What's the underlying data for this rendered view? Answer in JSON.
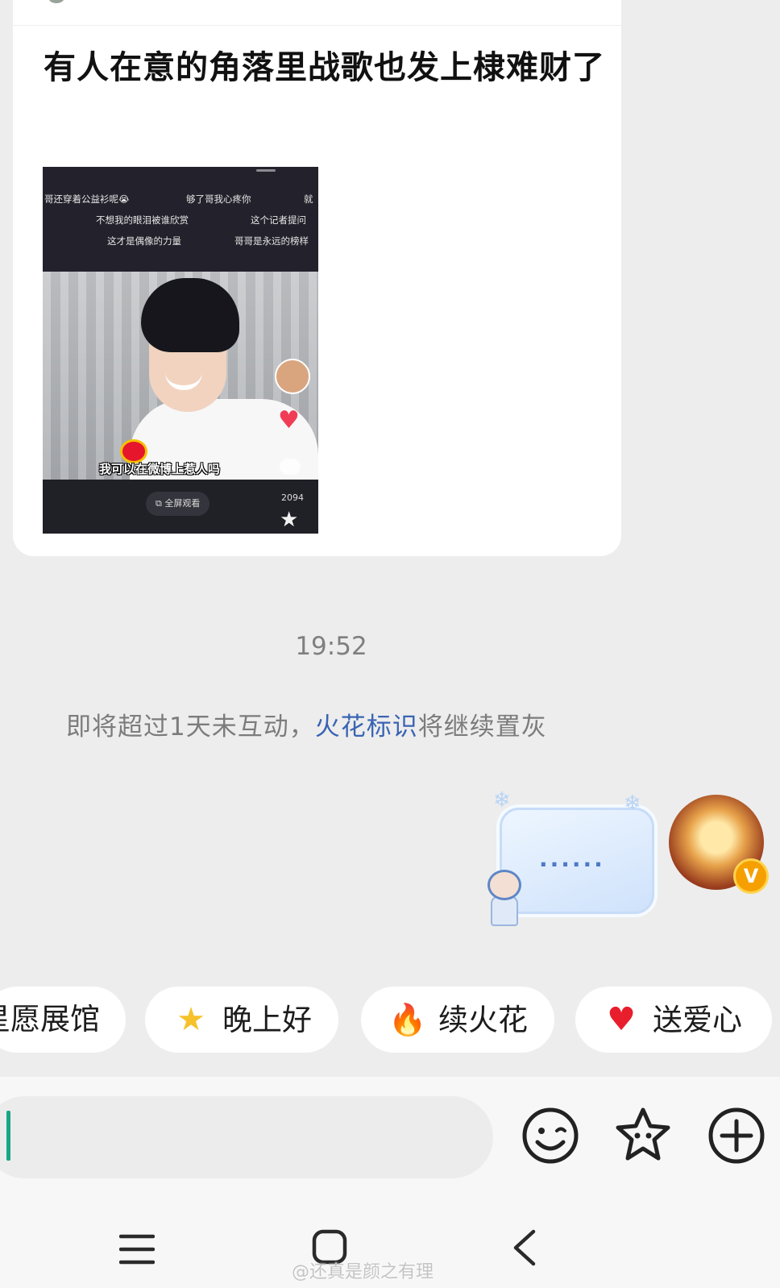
{
  "shared_post": {
    "title": "有人在意的角落里战歌也发上棣难财了",
    "video": {
      "danmaku": [
        "哥还穿着公益衫呢😭",
        "够了哥我心疼你",
        "就",
        "不想我的眼泪被谁欣赏",
        "这个记者提问",
        "这才是偶像的力量",
        "哥哥是永远的榜样"
      ],
      "subtitle": "我可以在微博上惹人吗",
      "fullscreen_label": "全屏观看",
      "comment_count": "2094"
    }
  },
  "chat": {
    "timestamp": "19:52",
    "notice_prefix": "即将超过1天未互动，",
    "notice_link": "火花标识",
    "notice_suffix": "将继续置灰",
    "my_message": "......",
    "vip_badge": "V"
  },
  "quick_replies": [
    {
      "label": "星愿展馆",
      "icon": ""
    },
    {
      "label": "晚上好",
      "icon": "star-face-icon"
    },
    {
      "label": "续火花",
      "icon": "fire-icon"
    },
    {
      "label": "送爱心",
      "icon": "heart-icon"
    }
  ],
  "input": {
    "value": ""
  },
  "toolbar_icons": [
    "emoji-icon",
    "sticker-icon",
    "plus-icon"
  ],
  "watermark": "@还真是颜之有理",
  "colors": {
    "link": "#3a64b3",
    "caret": "#1aa587",
    "background": "#ededed"
  }
}
